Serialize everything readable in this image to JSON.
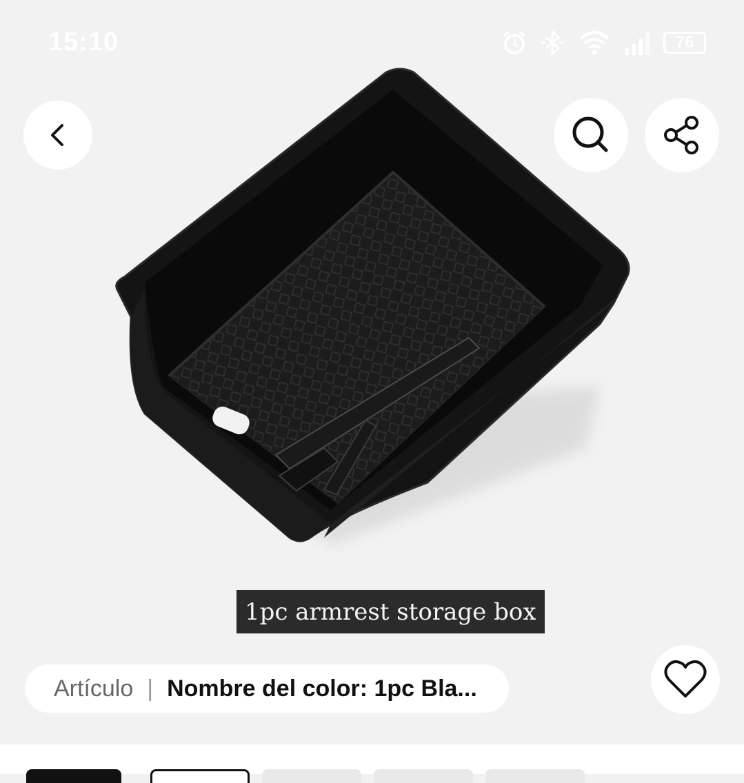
{
  "status_bar": {
    "time": "15:10",
    "battery": "76",
    "icons": [
      "alarm-icon",
      "bluetooth-icon",
      "wifi-icon",
      "signal-icon",
      "battery-icon"
    ]
  },
  "header": {
    "back_icon": "chevron-left-icon",
    "search_icon": "search-icon",
    "share_icon": "share-icon"
  },
  "product": {
    "image_caption": "1pc armrest storage box"
  },
  "variant": {
    "label": "Artículo",
    "separator": "|",
    "value": "Nombre del color: 1pc Bla..."
  },
  "favorite_icon": "heart-icon",
  "colors": {
    "background": "#f2f2f2",
    "caption_bg": "#2b2b2b",
    "text_dark": "#111111"
  }
}
